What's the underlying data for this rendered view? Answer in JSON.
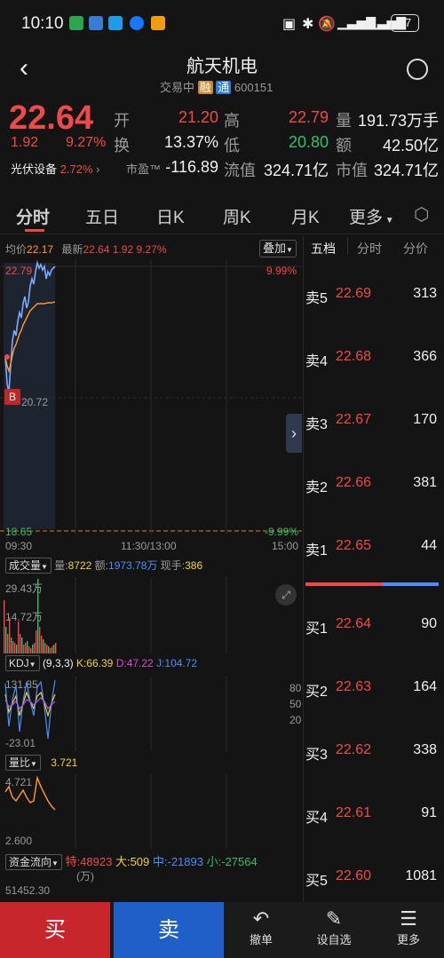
{
  "status": {
    "time": "10:10",
    "battery": "37",
    "signal_text": "4G"
  },
  "header": {
    "title": "航天机电",
    "trading_status": "交易中",
    "rong": "融",
    "tong": "通",
    "code": "600151"
  },
  "quote": {
    "price": "22.64",
    "change": "1.92",
    "change_pct": "9.27%",
    "sector": "光伏设备",
    "sector_pct": "2.72%",
    "open_label": "开",
    "open": "21.20",
    "high_label": "高",
    "high": "22.79",
    "volume_label": "量",
    "volume": "191.73万手",
    "turnover_label": "换",
    "turnover": "13.37%",
    "low_label": "低",
    "low": "20.80",
    "amount_label": "额",
    "amount": "42.50亿",
    "pe_label": "市盈™",
    "pe": "-116.89",
    "float_label": "流值",
    "float_value": "324.71亿",
    "mcap_label": "市值",
    "mcap": "324.71亿"
  },
  "tabs": [
    "分时",
    "五日",
    "日K",
    "周K",
    "月K",
    "更多"
  ],
  "chart": {
    "avg_label": "均价",
    "avg": "22.17",
    "latest_label": "最新",
    "latest": "22.64",
    "latest_chg": "1.92",
    "latest_pct": "9.27%",
    "overlay": "叠加",
    "y_high": "22.79",
    "y_high_pct": "9.99%",
    "y_mid": "20.72",
    "y_low": "18.65",
    "y_low_pct": "-9.99%",
    "t_start": "09:30",
    "t_mid": "11:30/13:00",
    "t_end": "15:00",
    "buy_marker": "B",
    "vol_label": "成交量",
    "vol_q_label": "量:",
    "vol_q": "8722",
    "vol_amt_label": "额:",
    "vol_amt": "1973.78万",
    "vol_now_label": "现手:",
    "vol_now": "386",
    "vol_top": "29.43万",
    "vol_mid": "14.72万",
    "kdj_label": "KDJ",
    "kdj_params": "(9,3,3)",
    "k": "K:66.39",
    "d": "D:47.22",
    "j": "J:104.72",
    "kdj_top": "131.85",
    "kdj_low": "-23.01",
    "kdj_80": "80",
    "kdj_50": "50",
    "kdj_20": "20",
    "lb_label": "量比",
    "lb": "3.721",
    "lb_top": "4.721",
    "lb_low": "2.600",
    "flow_label": "资金流向",
    "flow_te": "特:48923",
    "flow_da": "大:509",
    "flow_zhong": "中:-21893",
    "flow_xiao": "小:-27564",
    "flow_unit": "(万)",
    "flow_top": "51452.30"
  },
  "orderbook": {
    "tabs": [
      "五档",
      "分时",
      "分价"
    ],
    "sells": [
      {
        "l": "卖5",
        "p": "22.69",
        "v": "313"
      },
      {
        "l": "卖4",
        "p": "22.68",
        "v": "366"
      },
      {
        "l": "卖3",
        "p": "22.67",
        "v": "170"
      },
      {
        "l": "卖2",
        "p": "22.66",
        "v": "381"
      },
      {
        "l": "卖1",
        "p": "22.65",
        "v": "44"
      }
    ],
    "buys": [
      {
        "l": "买1",
        "p": "22.64",
        "v": "90"
      },
      {
        "l": "买2",
        "p": "22.63",
        "v": "164"
      },
      {
        "l": "买3",
        "p": "22.62",
        "v": "338"
      },
      {
        "l": "买4",
        "p": "22.61",
        "v": "91"
      },
      {
        "l": "买5",
        "p": "22.60",
        "v": "1081"
      }
    ]
  },
  "bottom": {
    "buy": "买",
    "sell": "卖",
    "cancel": "撤单",
    "watch": "设自选",
    "more": "更多"
  }
}
